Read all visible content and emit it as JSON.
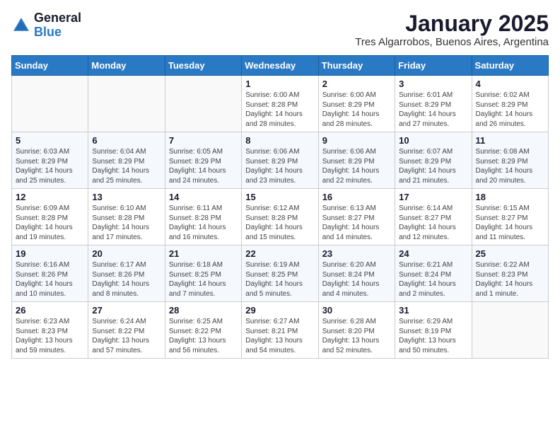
{
  "logo": {
    "general": "General",
    "blue": "Blue"
  },
  "header": {
    "month": "January 2025",
    "location": "Tres Algarrobos, Buenos Aires, Argentina"
  },
  "weekdays": [
    "Sunday",
    "Monday",
    "Tuesday",
    "Wednesday",
    "Thursday",
    "Friday",
    "Saturday"
  ],
  "weeks": [
    [
      {
        "day": "",
        "info": ""
      },
      {
        "day": "",
        "info": ""
      },
      {
        "day": "",
        "info": ""
      },
      {
        "day": "1",
        "info": "Sunrise: 6:00 AM\nSunset: 8:28 PM\nDaylight: 14 hours\nand 28 minutes."
      },
      {
        "day": "2",
        "info": "Sunrise: 6:00 AM\nSunset: 8:29 PM\nDaylight: 14 hours\nand 28 minutes."
      },
      {
        "day": "3",
        "info": "Sunrise: 6:01 AM\nSunset: 8:29 PM\nDaylight: 14 hours\nand 27 minutes."
      },
      {
        "day": "4",
        "info": "Sunrise: 6:02 AM\nSunset: 8:29 PM\nDaylight: 14 hours\nand 26 minutes."
      }
    ],
    [
      {
        "day": "5",
        "info": "Sunrise: 6:03 AM\nSunset: 8:29 PM\nDaylight: 14 hours\nand 25 minutes."
      },
      {
        "day": "6",
        "info": "Sunrise: 6:04 AM\nSunset: 8:29 PM\nDaylight: 14 hours\nand 25 minutes."
      },
      {
        "day": "7",
        "info": "Sunrise: 6:05 AM\nSunset: 8:29 PM\nDaylight: 14 hours\nand 24 minutes."
      },
      {
        "day": "8",
        "info": "Sunrise: 6:06 AM\nSunset: 8:29 PM\nDaylight: 14 hours\nand 23 minutes."
      },
      {
        "day": "9",
        "info": "Sunrise: 6:06 AM\nSunset: 8:29 PM\nDaylight: 14 hours\nand 22 minutes."
      },
      {
        "day": "10",
        "info": "Sunrise: 6:07 AM\nSunset: 8:29 PM\nDaylight: 14 hours\nand 21 minutes."
      },
      {
        "day": "11",
        "info": "Sunrise: 6:08 AM\nSunset: 8:29 PM\nDaylight: 14 hours\nand 20 minutes."
      }
    ],
    [
      {
        "day": "12",
        "info": "Sunrise: 6:09 AM\nSunset: 8:28 PM\nDaylight: 14 hours\nand 19 minutes."
      },
      {
        "day": "13",
        "info": "Sunrise: 6:10 AM\nSunset: 8:28 PM\nDaylight: 14 hours\nand 17 minutes."
      },
      {
        "day": "14",
        "info": "Sunrise: 6:11 AM\nSunset: 8:28 PM\nDaylight: 14 hours\nand 16 minutes."
      },
      {
        "day": "15",
        "info": "Sunrise: 6:12 AM\nSunset: 8:28 PM\nDaylight: 14 hours\nand 15 minutes."
      },
      {
        "day": "16",
        "info": "Sunrise: 6:13 AM\nSunset: 8:27 PM\nDaylight: 14 hours\nand 14 minutes."
      },
      {
        "day": "17",
        "info": "Sunrise: 6:14 AM\nSunset: 8:27 PM\nDaylight: 14 hours\nand 12 minutes."
      },
      {
        "day": "18",
        "info": "Sunrise: 6:15 AM\nSunset: 8:27 PM\nDaylight: 14 hours\nand 11 minutes."
      }
    ],
    [
      {
        "day": "19",
        "info": "Sunrise: 6:16 AM\nSunset: 8:26 PM\nDaylight: 14 hours\nand 10 minutes."
      },
      {
        "day": "20",
        "info": "Sunrise: 6:17 AM\nSunset: 8:26 PM\nDaylight: 14 hours\nand 8 minutes."
      },
      {
        "day": "21",
        "info": "Sunrise: 6:18 AM\nSunset: 8:25 PM\nDaylight: 14 hours\nand 7 minutes."
      },
      {
        "day": "22",
        "info": "Sunrise: 6:19 AM\nSunset: 8:25 PM\nDaylight: 14 hours\nand 5 minutes."
      },
      {
        "day": "23",
        "info": "Sunrise: 6:20 AM\nSunset: 8:24 PM\nDaylight: 14 hours\nand 4 minutes."
      },
      {
        "day": "24",
        "info": "Sunrise: 6:21 AM\nSunset: 8:24 PM\nDaylight: 14 hours\nand 2 minutes."
      },
      {
        "day": "25",
        "info": "Sunrise: 6:22 AM\nSunset: 8:23 PM\nDaylight: 14 hours\nand 1 minute."
      }
    ],
    [
      {
        "day": "26",
        "info": "Sunrise: 6:23 AM\nSunset: 8:23 PM\nDaylight: 13 hours\nand 59 minutes."
      },
      {
        "day": "27",
        "info": "Sunrise: 6:24 AM\nSunset: 8:22 PM\nDaylight: 13 hours\nand 57 minutes."
      },
      {
        "day": "28",
        "info": "Sunrise: 6:25 AM\nSunset: 8:22 PM\nDaylight: 13 hours\nand 56 minutes."
      },
      {
        "day": "29",
        "info": "Sunrise: 6:27 AM\nSunset: 8:21 PM\nDaylight: 13 hours\nand 54 minutes."
      },
      {
        "day": "30",
        "info": "Sunrise: 6:28 AM\nSunset: 8:20 PM\nDaylight: 13 hours\nand 52 minutes."
      },
      {
        "day": "31",
        "info": "Sunrise: 6:29 AM\nSunset: 8:19 PM\nDaylight: 13 hours\nand 50 minutes."
      },
      {
        "day": "",
        "info": ""
      }
    ]
  ]
}
